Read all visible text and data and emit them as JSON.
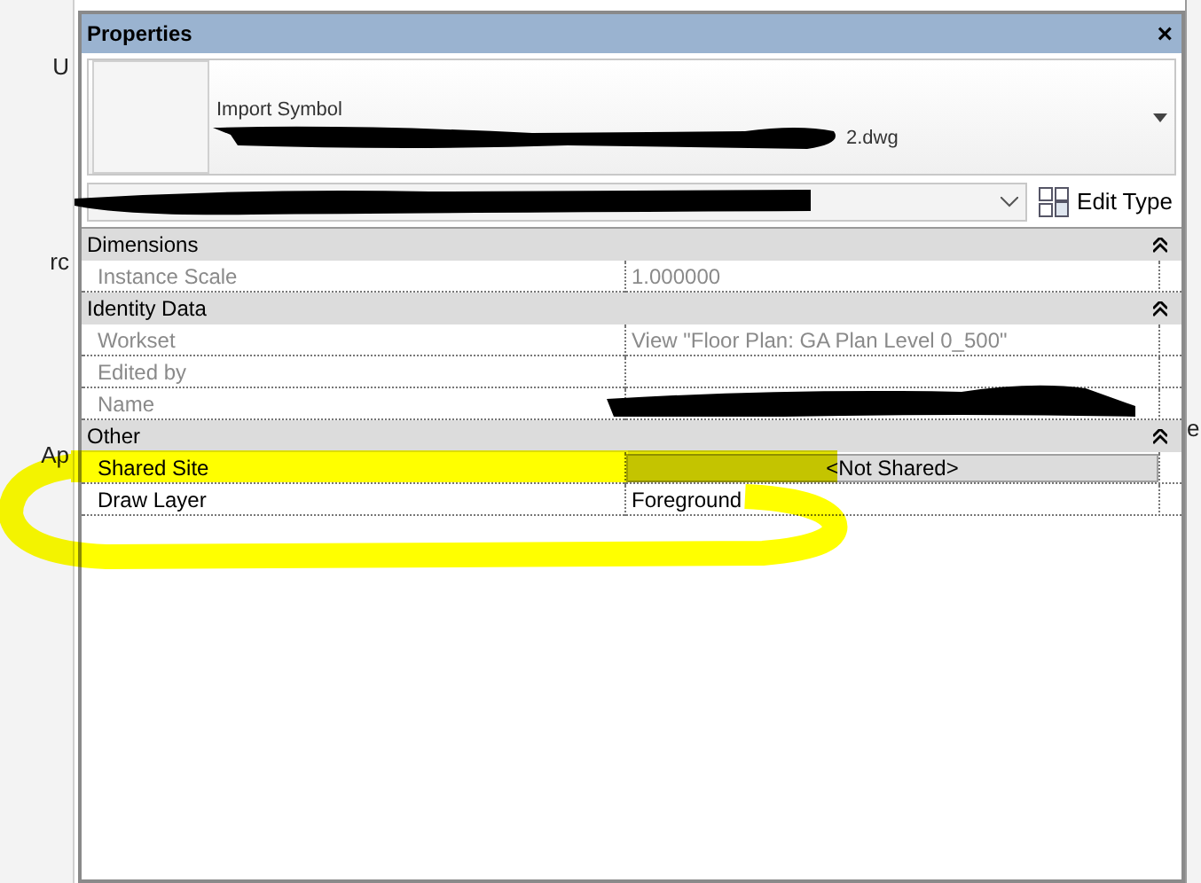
{
  "background": {
    "left_fragments": [
      "U",
      "rc",
      "Ap"
    ],
    "right_fragments": [
      "e"
    ]
  },
  "window": {
    "title": "Properties",
    "close": "×"
  },
  "type_selector": {
    "category": "Import Symbol",
    "name": "2.dwg",
    "redacted": true
  },
  "instance_filter": {
    "redacted": true
  },
  "edit_type_button": {
    "label": "Edit Type"
  },
  "groups": [
    {
      "name": "Dimensions",
      "expanded": true,
      "properties": [
        {
          "name": "Instance Scale",
          "value": "1.000000",
          "disabled": true,
          "kind": "text"
        }
      ]
    },
    {
      "name": "Identity Data",
      "expanded": true,
      "properties": [
        {
          "name": "Workset",
          "value": "View \"Floor Plan: GA Plan Level 0_500\"",
          "disabled": true,
          "kind": "text"
        },
        {
          "name": "Edited by",
          "disabled": true,
          "kind": "text"
        },
        {
          "name": "Name",
          "disabled": true,
          "kind": "text",
          "redacted": true
        }
      ]
    },
    {
      "name": "Other",
      "expanded": true,
      "properties": [
        {
          "name": "Shared Site",
          "value": "<Not Shared>",
          "disabled": false,
          "kind": "button"
        },
        {
          "name": "Draw Layer",
          "value": "Foreground",
          "disabled": false,
          "kind": "text"
        }
      ]
    }
  ],
  "highlight": {
    "on": true
  }
}
